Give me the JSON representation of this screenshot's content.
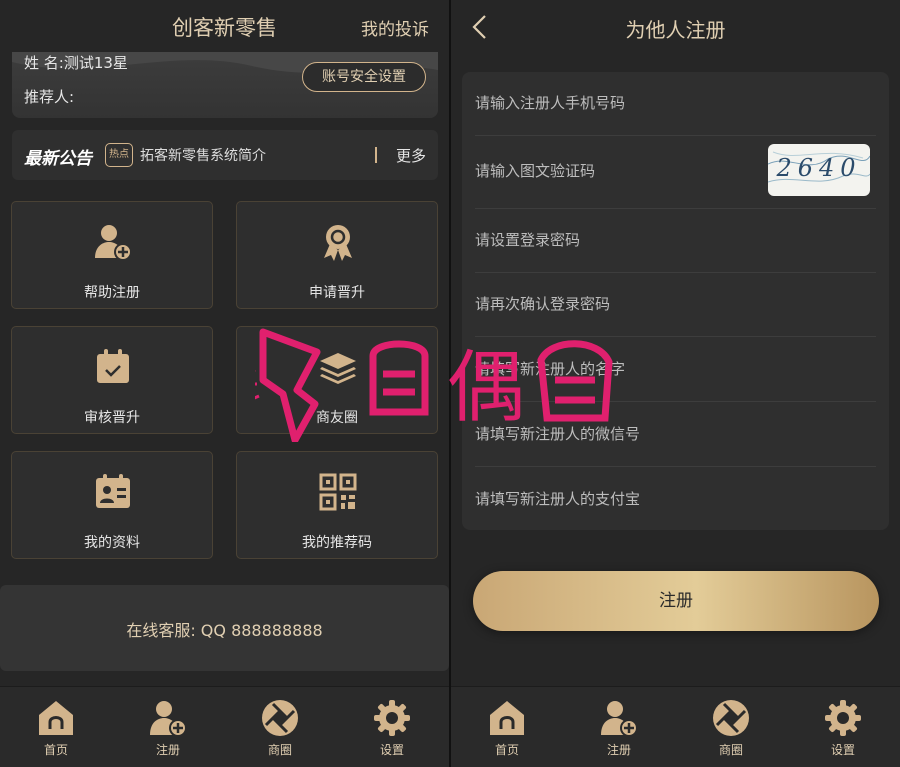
{
  "left": {
    "header": {
      "title": "创客新零售",
      "link": "我的投诉"
    },
    "user": {
      "name": "姓 名:测试13星",
      "referrer": "推荐人:",
      "security_button": "账号安全设置"
    },
    "notice": {
      "title": "最新公告",
      "tag": "热点",
      "text": "拓客新零售系统简介",
      "more": "更多"
    },
    "tiles": [
      {
        "label": "帮助注册",
        "icon": "add-user-icon"
      },
      {
        "label": "申请晋升",
        "icon": "medal-icon"
      },
      {
        "label": "审核晋升",
        "icon": "calendar-check-icon"
      },
      {
        "label": "商友圈",
        "icon": "layers-icon"
      },
      {
        "label": "我的资料",
        "icon": "id-card-icon"
      },
      {
        "label": "我的推荐码",
        "icon": "qr-code-icon"
      }
    ],
    "service": "在线客服: QQ 888888888"
  },
  "right": {
    "title": "为他人注册",
    "fields": [
      "请输入注册人手机号码",
      "请输入图文验证码",
      "请设置登录密码",
      "请再次确认登录密码",
      "请填写新注册人的名字",
      "请填写新注册人的微信号",
      "请填写新注册人的支付宝"
    ],
    "captcha": "2640",
    "register_button": "注册"
  },
  "tabbar": [
    {
      "label": "首页",
      "icon": "home-icon"
    },
    {
      "label": "注册",
      "icon": "add-user-icon"
    },
    {
      "label": "商圈",
      "icon": "aperture-icon"
    },
    {
      "label": "设置",
      "icon": "gear-icon"
    }
  ],
  "watermark": "偶",
  "colors": {
    "gold": "#d2b48c",
    "background": "#262626",
    "watermark": "#e0206e"
  }
}
